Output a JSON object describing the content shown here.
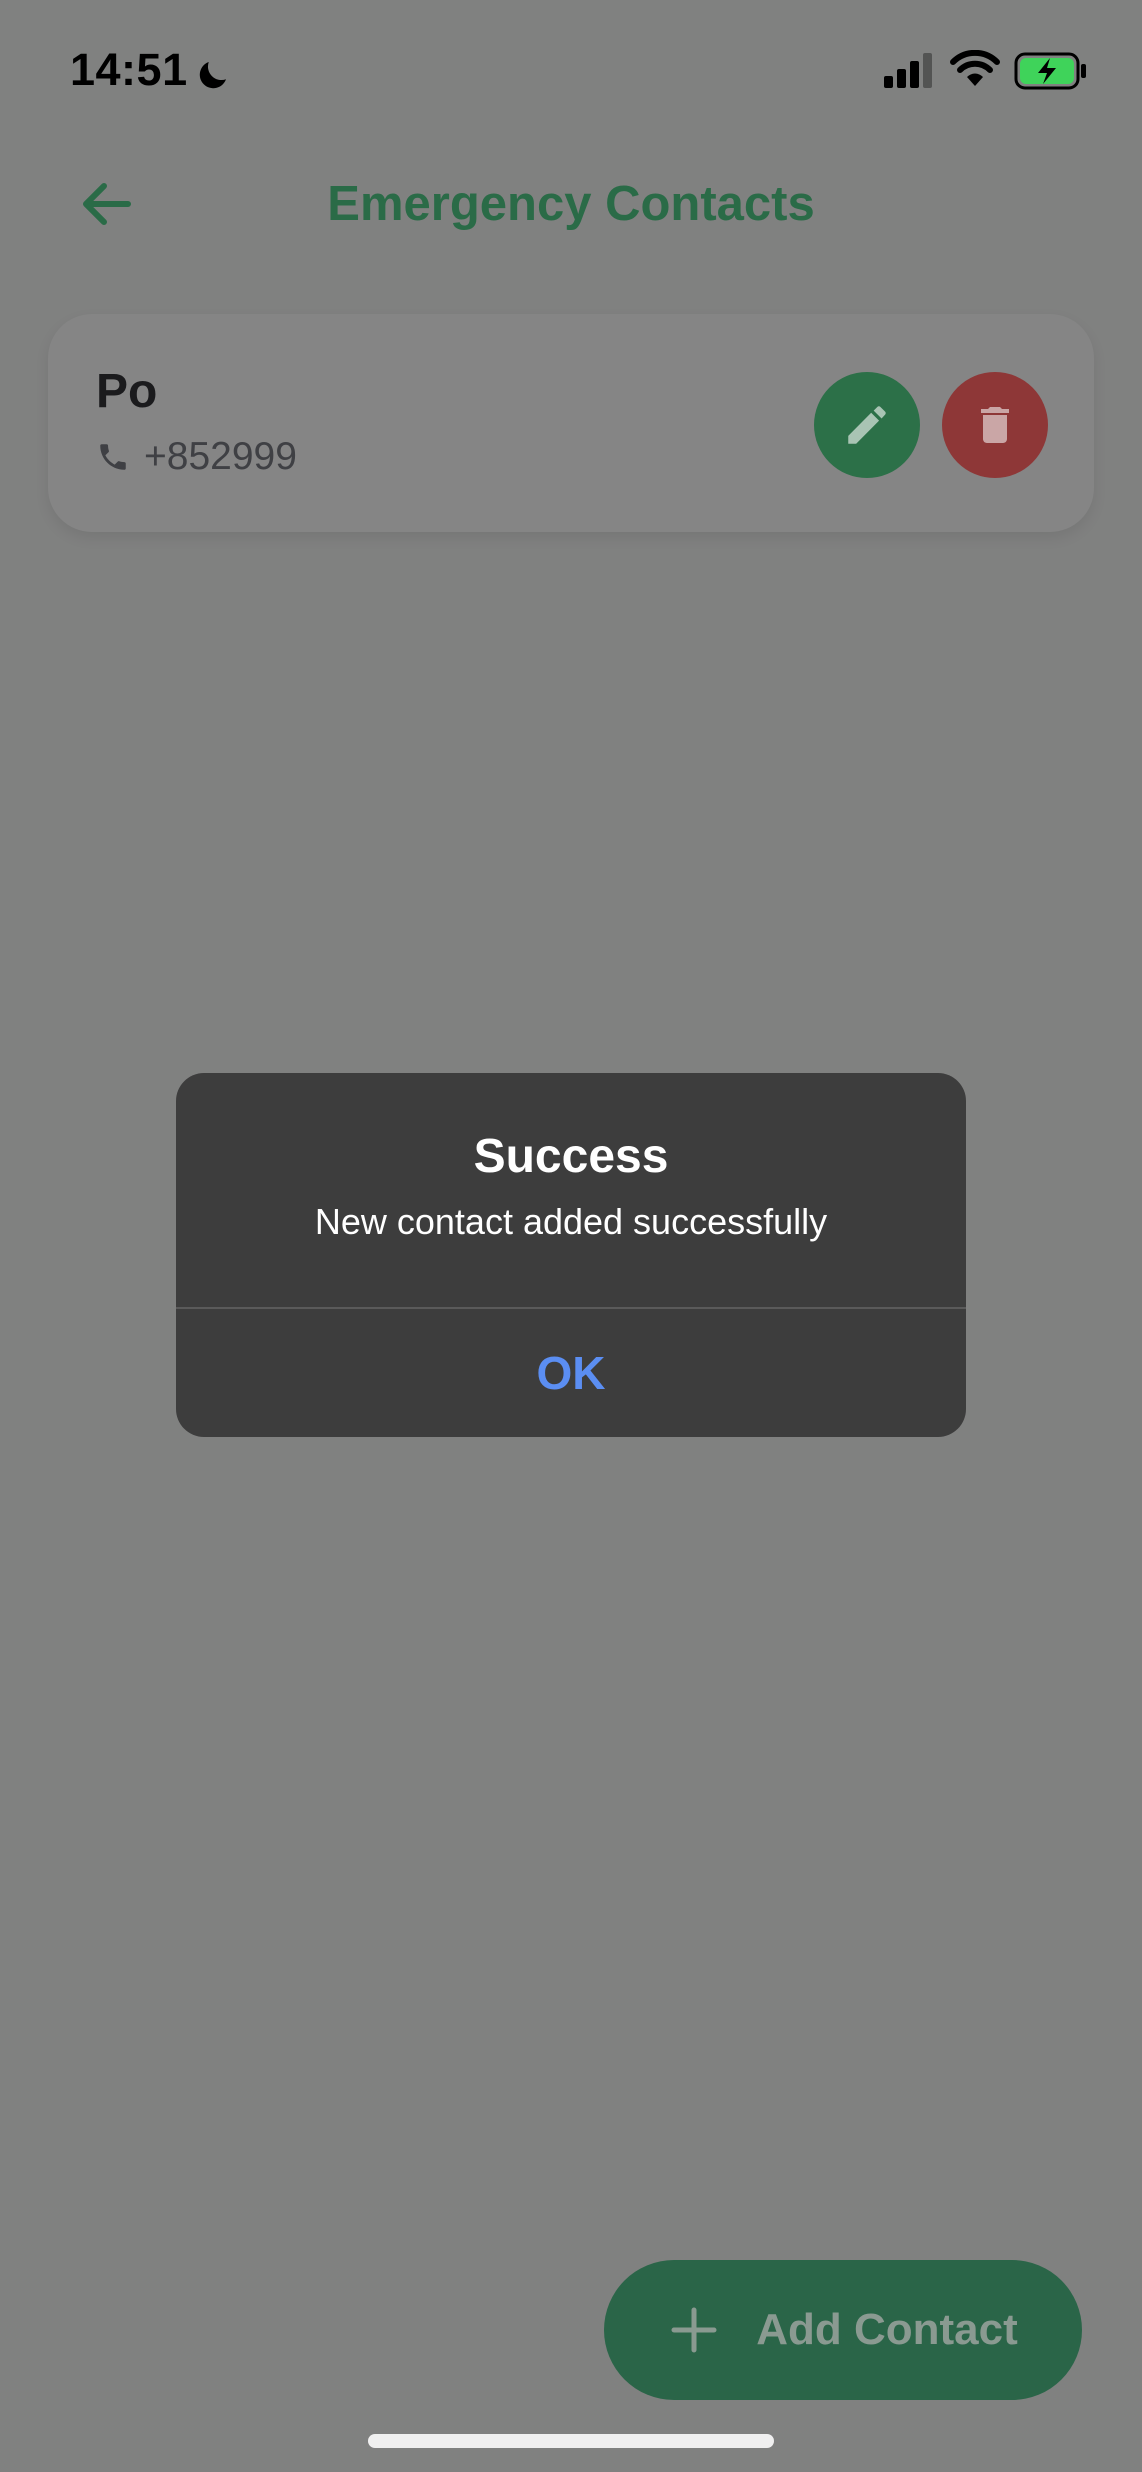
{
  "status_bar": {
    "time": "14:51",
    "icons": [
      "moon-icon",
      "cellular-signal-icon",
      "wifi-icon",
      "battery-charging-icon"
    ]
  },
  "header": {
    "title": "Emergency Contacts",
    "back_icon": "arrow-left-icon"
  },
  "contacts": [
    {
      "name": "Po",
      "phone": "+852999",
      "edit_icon": "pencil-icon",
      "delete_icon": "trash-icon"
    }
  ],
  "alert": {
    "title": "Success",
    "message": "New contact added successfully",
    "ok_label": "OK"
  },
  "fab": {
    "label": "Add Contact",
    "icon": "plus-icon"
  },
  "colors": {
    "accent_green": "#2a6b47",
    "delete_red": "#8e3737",
    "alert_bg": "#3d3d3d",
    "alert_link": "#5b8ef2"
  }
}
